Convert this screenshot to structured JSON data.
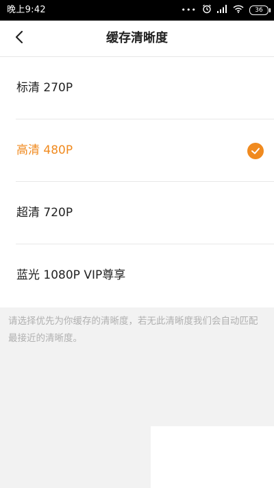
{
  "status_bar": {
    "time": "晚上9:42",
    "dots": "•••",
    "battery": "36",
    "icons": [
      "alarm-icon",
      "signal-icon",
      "wifi-icon",
      "battery-icon"
    ]
  },
  "header": {
    "title": "缓存清晰度",
    "back_icon": "chevron-left-icon"
  },
  "options": [
    {
      "label": "标清 270P",
      "selected": false
    },
    {
      "label": "高清 480P",
      "selected": true
    },
    {
      "label": "超清 720P",
      "selected": false
    },
    {
      "label": "蓝光 1080P  VIP尊享",
      "selected": false
    }
  ],
  "hint": "请选择优先为你缓存的清晰度，若无此清晰度我们会自动匹配最接近的清晰度。",
  "colors": {
    "accent": "#f08a1f",
    "background": "#f2f2f2",
    "text": "#222222",
    "hint": "#b0b0b0"
  }
}
